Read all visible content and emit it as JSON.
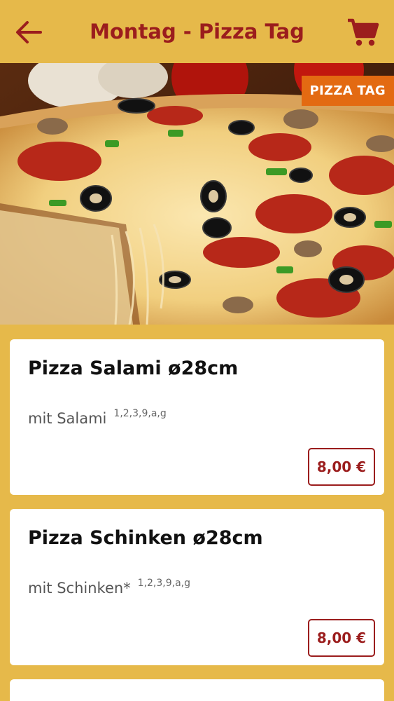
{
  "header": {
    "title": "Montag - Pizza Tag",
    "back_icon": "arrow-left-icon",
    "cart_icon": "shopping-cart-icon"
  },
  "hero": {
    "badge": "PIZZA TAG"
  },
  "colors": {
    "background": "#e6b94a",
    "accent": "#9b1d1d",
    "badge": "#e36a12"
  },
  "products": [
    {
      "name": "Pizza Salami ø28cm",
      "description": "mit Salami",
      "allergens": "1,2,3,9,a,g",
      "price": "8,00 €"
    },
    {
      "name": "Pizza Schinken ø28cm",
      "description": "mit Schinken*",
      "allergens": "1,2,3,9,a,g",
      "price": "8,00 €"
    },
    {
      "name": "",
      "description": "",
      "allergens": "",
      "price": ""
    }
  ]
}
